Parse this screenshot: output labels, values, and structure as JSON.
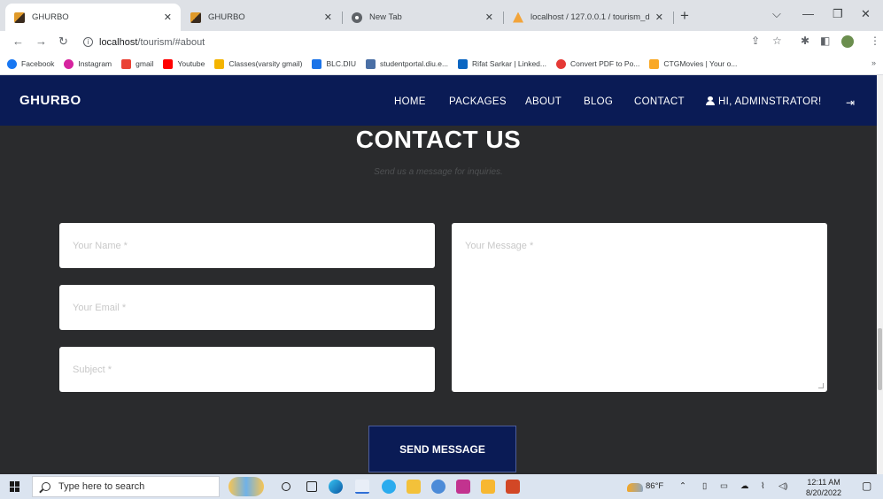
{
  "browser": {
    "tabs": [
      {
        "label": "GHURBO",
        "active": true,
        "icon": "ghurbo-favicon"
      },
      {
        "label": "GHURBO",
        "active": false,
        "icon": "ghurbo-favicon"
      },
      {
        "label": "New Tab",
        "active": false,
        "icon": "chrome-favicon"
      },
      {
        "label": "localhost / 127.0.0.1 / tourism_d",
        "active": false,
        "icon": "phpmyadmin-favicon"
      }
    ],
    "address": {
      "host": "localhost",
      "path": "/tourism/#about"
    },
    "bookmarks": [
      {
        "label": "Facebook",
        "color": "#1877f2"
      },
      {
        "label": "Instagram",
        "color": "#d6249f"
      },
      {
        "label": "gmail",
        "color": "#ea4335"
      },
      {
        "label": "Youtube",
        "color": "#ff0000"
      },
      {
        "label": "Classes(varsity gmail)",
        "color": "#f4b400"
      },
      {
        "label": "BLC.DIU",
        "color": "#1a73e8"
      },
      {
        "label": "studentportal.diu.e...",
        "color": "#4a6fa5"
      },
      {
        "label": "Rifat Sarkar | Linked...",
        "color": "#0a66c2"
      },
      {
        "label": "Convert PDF to Po...",
        "color": "#e53935"
      },
      {
        "label": "CTGMovies | Your o...",
        "color": "#f9a825"
      }
    ]
  },
  "site": {
    "brand": "GHURBO",
    "nav": [
      "HOME",
      "PACKAGES",
      "ABOUT",
      "BLOG",
      "CONTACT"
    ],
    "user_greeting": "HI, ADMINSTRATOR!"
  },
  "contact": {
    "title": "CONTACT US",
    "subtitle": "Send us a message for inquiries.",
    "name_placeholder": "Your Name *",
    "email_placeholder": "Your Email *",
    "subject_placeholder": "Subject *",
    "message_placeholder": "Your Message *",
    "send_label": "SEND MESSAGE"
  },
  "taskbar": {
    "search_placeholder": "Type here to search",
    "weather": "86°F",
    "time": "12:11 AM",
    "date": "8/20/2022"
  }
}
